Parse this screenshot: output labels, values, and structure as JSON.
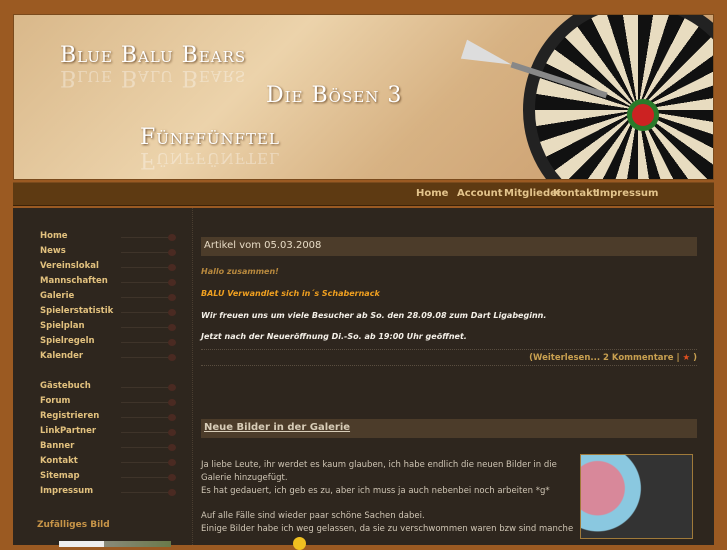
{
  "header": {
    "title": "Blue Balu Bears",
    "subtitle": "Die Bösen 3",
    "tagline": "Fünffünftel"
  },
  "topnav": [
    "Home",
    "Account",
    "Mitglieder",
    "Kontakt",
    "Impressum"
  ],
  "sidebar": {
    "items": [
      "Home",
      "News",
      "Vereinslokal",
      "Mannschaften",
      "Galerie",
      "Spielerstatistik",
      "Spielplan",
      "Spielregeln",
      "Kalender"
    ],
    "items2": [
      "Gästebuch",
      "Forum",
      "Registrieren",
      "LinkPartner",
      "Banner",
      "Kontakt",
      "Sitemap",
      "Impressum"
    ],
    "random_image_title": "Zufälliges Bild"
  },
  "article1": {
    "title": "Artikel vom 05.03.2008",
    "greeting": "Hallo zusammen!",
    "headline": "BALU Verwandlet sich in´s Schabernack",
    "line1": "Wir freuen uns um viele Besucher ab So. den 28.09.08 zum Dart Ligabeginn.",
    "line2": "Jetzt nach der Neueröffnung Di.-So. ab 19:00 Uhr geöffnet.",
    "readmore": "(Weiterlesen...",
    "comments": "2 Kommentare",
    "sep": "|",
    "close": ")"
  },
  "article2": {
    "title": "Neue Bilder in der Galerie",
    "p1": "Ja liebe Leute, ihr werdet es kaum glauben, ich habe endlich die neuen Bilder in die Galerie hinzugefügt.",
    "p2": "Es hat gedauert, ich geb es zu, aber ich muss ja auch nebenbei noch arbeiten *g*",
    "p3": "Auf alle Fälle sind wieder paar schöne Sachen dabei.",
    "p4": "Einige Bilder habe ich weg gelassen, da sie zu verschwommen waren bzw sind manche"
  }
}
